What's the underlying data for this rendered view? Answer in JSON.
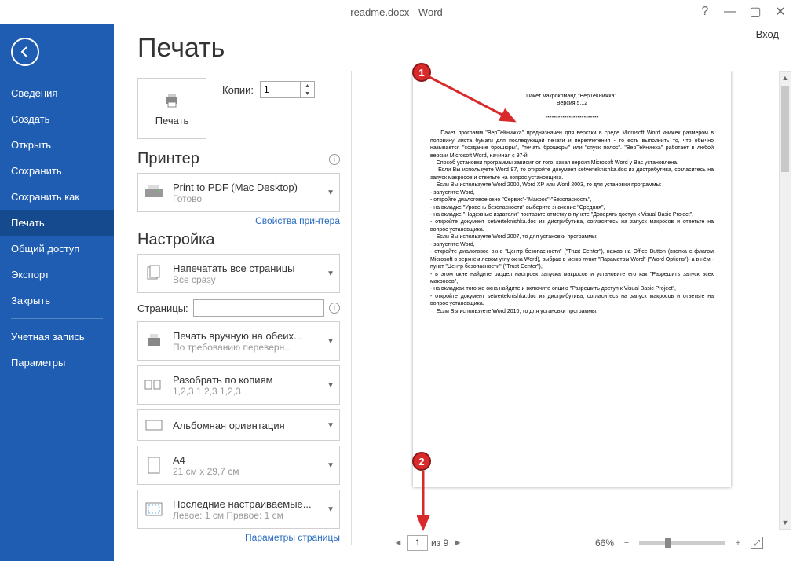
{
  "window": {
    "title": "readme.docx - Word",
    "login": "Вход"
  },
  "sidebar": {
    "items": [
      "Сведения",
      "Создать",
      "Открыть",
      "Сохранить",
      "Сохранить как",
      "Печать",
      "Общий доступ",
      "Экспорт",
      "Закрыть"
    ],
    "bottom": [
      "Учетная запись",
      "Параметры"
    ],
    "active_index": 5
  },
  "page": {
    "title": "Печать",
    "print_button": "Печать",
    "copies_label": "Копии:",
    "copies_value": "1",
    "printer_section": "Принтер",
    "printer_name": "Print to PDF (Mac Desktop)",
    "printer_status": "Готово",
    "printer_props_link": "Свойства принтера",
    "settings_section": "Настройка",
    "opt_pages_all_1": "Напечатать все страницы",
    "opt_pages_all_2": "Все сразу",
    "pages_label": "Страницы:",
    "opt_duplex_1": "Печать вручную на обеих...",
    "opt_duplex_2": "По требованию переверн...",
    "opt_collate_1": "Разобрать по копиям",
    "opt_collate_2": "1,2,3   1,2,3   1,2,3",
    "opt_orient_1": "Альбомная ориентация",
    "opt_paper_1": "A4",
    "opt_paper_2": "21 см x 29,7 см",
    "opt_margins_1": "Последние настраиваемые...",
    "opt_margins_2": "Левое: 1 см   Правое: 1 см",
    "page_setup_link": "Параметры страницы"
  },
  "preview": {
    "page_input": "1",
    "page_total_label": "из 9",
    "zoom_label": "66%"
  },
  "document": {
    "title_line": "Пакет макрокоманд \"ВерТеКнижка\".",
    "version_line": "Версия 5.12",
    "separator": "*************************",
    "body": "    Пакет программ \"ВерТеКнижка\" предназначен для верстки в среде Microsoft Word книжек размером в половину листа бумаги для последующей печати и перeплетения - то есть выполнить то, что обычно называется \"создание брошюры\", \"печать брошюры\" или \"спуск полос\". \"ВерТеКнижка\" работает в любой версии Microsoft Word, начиная с 97-й.\n    Способ установки программы зависит от того, какая версия Microsoft Word у Вас установлена.\n    Если Вы используете Word 97, то откройте документ setverteknishka.doc из дистрибутива, согласитесь на запуск макросов и ответьте на вопрос установщика.\n    Если Вы используете Word 2000, Word XP или Word 2003, то для установки программы:\n- запустите Word,\n- откройте диалоговое окно \"Сервис\"-\"Макрос\"-\"Безопасность\",\n- на вкладке \"Уровень безопасности\" выберите значение \"Средняя\",\n- на вкладке \"Надежные издатели\" поставьте отметку в пункте \"Доверять доступ к Visual Basic Project\",\n- откройте документ setverteknishka.doc из дистрибутива, согласитесь на запуск макросов и ответьте на вопрос установщика.\n    Если Вы используете Word 2007, то для установки программы:\n- запустите Word,\n- откройте диалоговое окно \"Центр безопасности\" (\"Trust Center\"), нажав на Office Button (кнопка с флагом Microsoft в верхнем левом углу окна Word), выбрав в меню пункт \"Параметры Word\" (\"Word Options\"), а в нём - пункт \"Центр безопасности\" (\"Trust Center\"),\n- в этом окне найдите раздел настроек запуска макросов и установите его как \"Разрешить запуск всех макросов\",\n- на вкладках того же окна найдите и включите опцию \"Разрешить доступ к Visual Basic Project\",\n- откройте документ setverteknishka.doc из дистрибутива, согласитесь на запуск макросов и ответьте на вопрос установщика.\n    Если Вы используете Word 2010, то для установки программы:"
  },
  "annotations": {
    "a1": "1",
    "a2": "2"
  }
}
